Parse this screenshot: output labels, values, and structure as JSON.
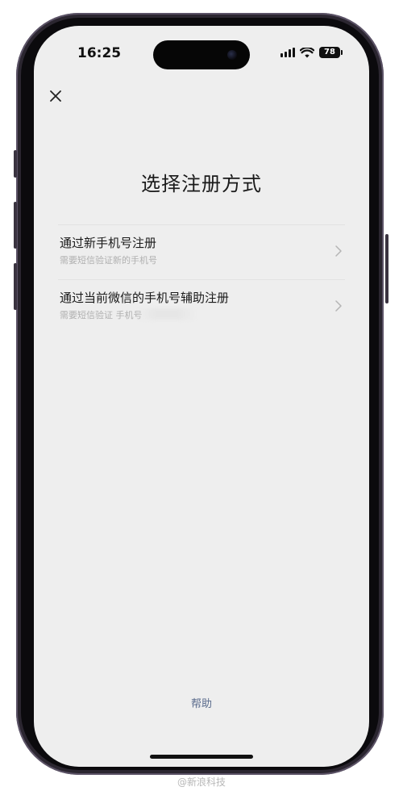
{
  "status_bar": {
    "time": "16:25",
    "battery": "78"
  },
  "page": {
    "title": "选择注册方式",
    "help": "帮助"
  },
  "options": [
    {
      "label": "通过新手机号注册",
      "sub": "需要短信验证新的手机号"
    },
    {
      "label": "通过当前微信的手机号辅助注册",
      "sub": "需要短信验证      手机号"
    }
  ],
  "watermark": "@新浪科技",
  "colors": {
    "screen_bg": "#eeeeee",
    "link": "#5a6b8c",
    "subtext": "#b0b0b0"
  },
  "icons": [
    "close-icon",
    "chevron-right-icon",
    "signal-icon",
    "wifi-icon",
    "battery-icon"
  ]
}
